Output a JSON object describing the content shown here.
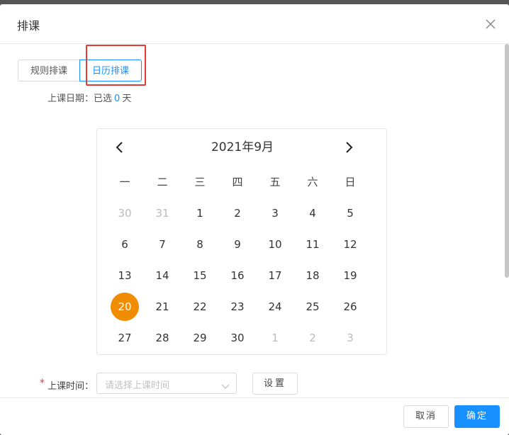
{
  "dialog": {
    "title": "排课"
  },
  "tabs": [
    {
      "label": "规则排课",
      "active": false
    },
    {
      "label": "日历排课",
      "active": true
    }
  ],
  "date_summary": {
    "label": "上课日期：",
    "prefix": "已选",
    "count": "0",
    "suffix": "天"
  },
  "calendar": {
    "title": "2021年9月",
    "weekdays": [
      "一",
      "二",
      "三",
      "四",
      "五",
      "六",
      "日"
    ],
    "weeks": [
      [
        "30",
        "31",
        "1",
        "2",
        "3",
        "4",
        "5"
      ],
      [
        "6",
        "7",
        "8",
        "9",
        "10",
        "11",
        "12"
      ],
      [
        "13",
        "14",
        "15",
        "16",
        "17",
        "18",
        "19"
      ],
      [
        "20",
        "21",
        "22",
        "23",
        "24",
        "25",
        "26"
      ],
      [
        "27",
        "28",
        "29",
        "30",
        "1",
        "2",
        "3"
      ]
    ],
    "selected": "20",
    "selected_color": "#f08c00"
  },
  "time": {
    "label": "上课时间：",
    "placeholder": "请选择上课时间",
    "set_button": "设置"
  },
  "footer": {
    "cancel": "取消",
    "ok": "确定"
  },
  "colors": {
    "accent": "#1890ff",
    "highlight": "#e53935"
  }
}
